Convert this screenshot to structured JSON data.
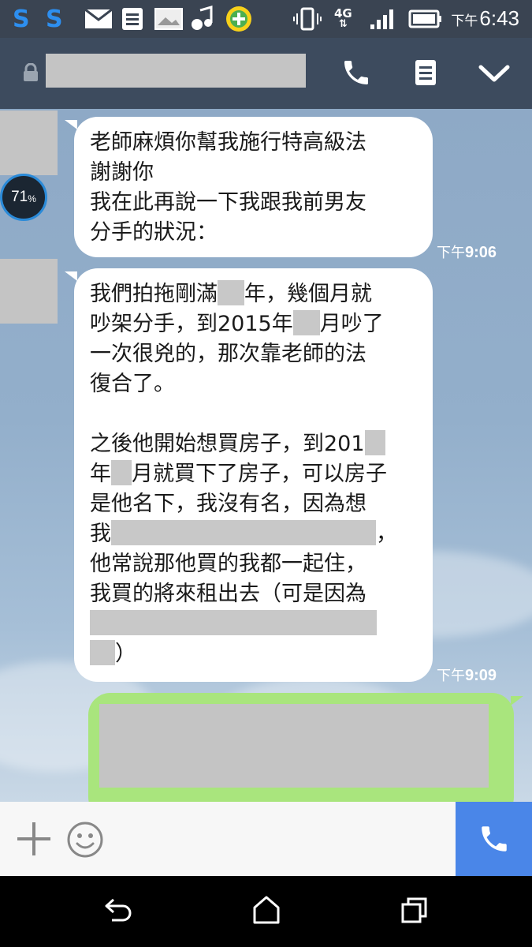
{
  "status_bar": {
    "network": "4G",
    "time_prefix": "下午",
    "time": "6:43"
  },
  "widget": {
    "battery_percent": "71",
    "percent_sign": "%"
  },
  "messages": [
    {
      "lines": [
        "老師麻煩你幫我施行特高級法",
        "謝謝你",
        "我在此再說一下我跟我前男友",
        "分手的狀況："
      ],
      "time_prefix": "下午",
      "time": "9:06"
    },
    {
      "segments": {
        "l1a": "我們拍拖剛滿",
        "l1b": "年，幾個月就",
        "l2a": "吵架分手，到2015年",
        "l2b": "月吵了",
        "l3": "一次很兇的，那次靠老師的法",
        "l4": "復合了。",
        "l6a": "之後他開始想買房子，到201",
        "l7a": "年",
        "l7b": "月就買下了房子，可以房子",
        "l8": "是他名下，我沒有名，因為想",
        "l9a": "我",
        "l9b": "，",
        "l10": "他常說那他買的我都一起住，",
        "l11": "我買的將來租出去（可是因為",
        "l13b": "）"
      },
      "time_prefix": "下午",
      "time": "9:09"
    }
  ],
  "colors": {
    "header": "#3d4b5e",
    "incoming_bubble": "#ffffff",
    "outgoing_bubble": "#a9e57d",
    "call_button": "#4a86e8"
  },
  "icons": {
    "lock": "lock-icon",
    "call": "phone-icon",
    "notes": "notes-icon",
    "collapse": "chevron-down-icon",
    "add": "plus-icon",
    "emoji": "smiley-icon",
    "back": "back-icon",
    "home": "home-icon",
    "recent": "recent-apps-icon"
  }
}
